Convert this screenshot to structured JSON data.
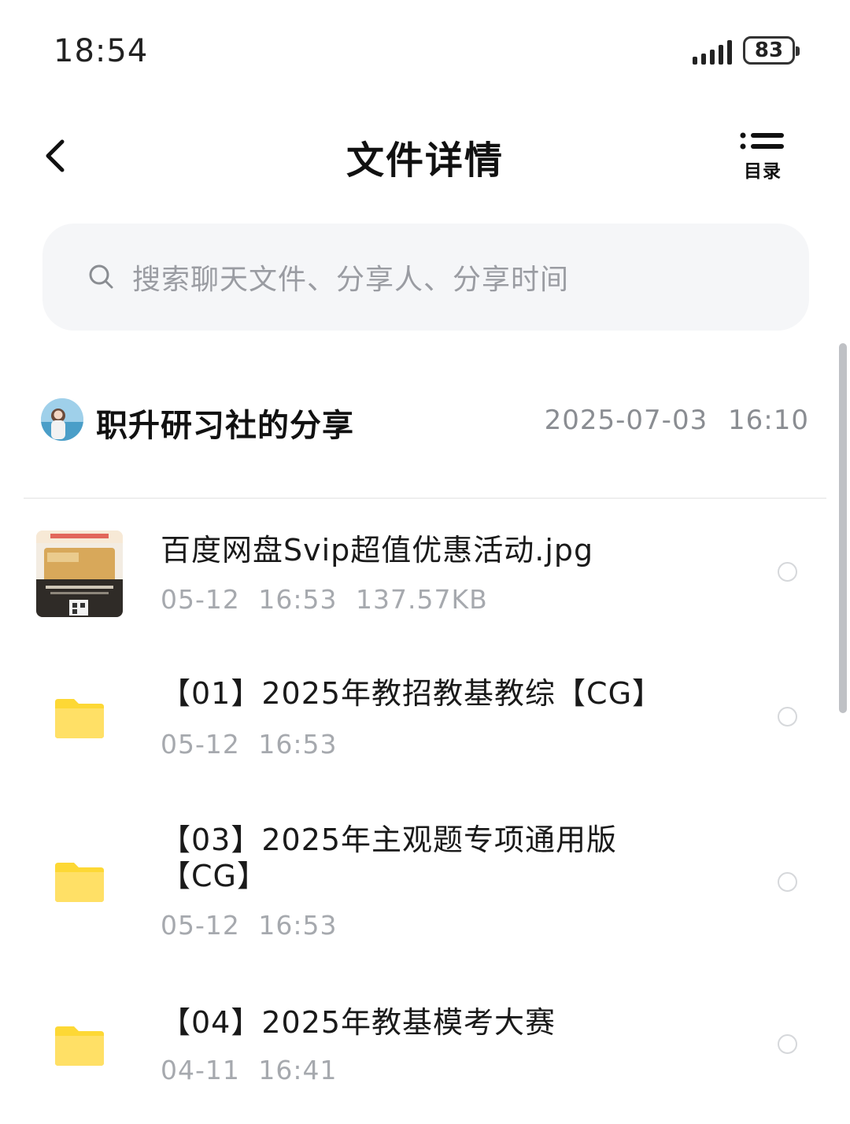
{
  "status_bar": {
    "time": "18:54",
    "battery": "83"
  },
  "header": {
    "title": "文件详情",
    "back_icon": "chevron-left-icon",
    "toc_label": "目录"
  },
  "search": {
    "placeholder": "搜索聊天文件、分享人、分享时间"
  },
  "share": {
    "name": "职升研习社的分享",
    "time": "2025-07-03  16:10"
  },
  "files": [
    {
      "type": "image",
      "name": "百度网盘Svip超值优惠活动.jpg",
      "date": "05-12",
      "time": "16:53",
      "size": "137.57KB"
    },
    {
      "type": "folder",
      "name": "【01】2025年教招教基教综【CG】",
      "date": "05-12",
      "time": "16:53"
    },
    {
      "type": "folder",
      "name": "【03】2025年主观题专项通用版【CG】",
      "date": "05-12",
      "time": "16:53"
    },
    {
      "type": "folder",
      "name": "【04】2025年教基模考大赛",
      "date": "04-11",
      "time": "16:41"
    }
  ],
  "colors": {
    "folder": "#FDD835",
    "meta_text": "#A6A9AE",
    "search_bg": "#F5F6F8"
  }
}
